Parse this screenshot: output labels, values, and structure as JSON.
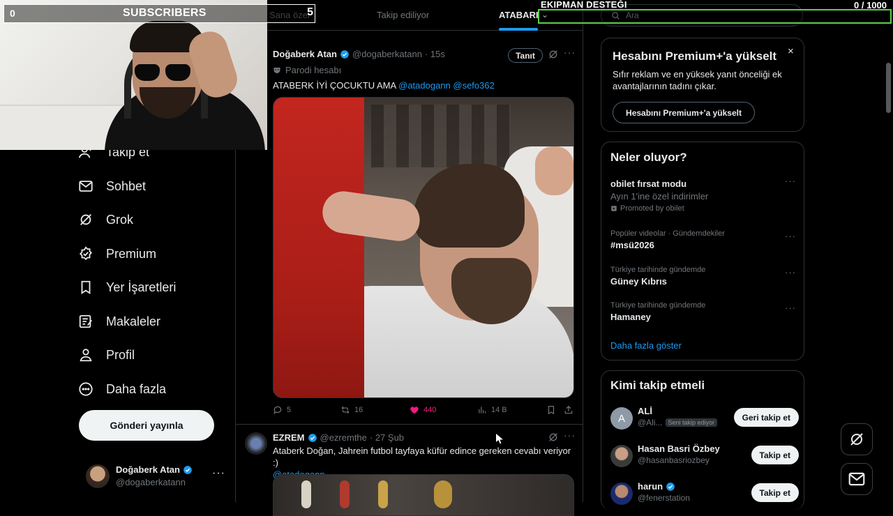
{
  "overlay": {
    "subscribers_count": "0",
    "subscribers_label": "SUBSCRIBERS",
    "subscribers_goal": "5",
    "equipment_title": "EKIPMAN DESTEĞI",
    "equipment_progress": "0   / 1000"
  },
  "nav": {
    "items": [
      {
        "label": "Takip et",
        "icon": "add-user-icon"
      },
      {
        "label": "Sohbet",
        "icon": "mail-icon"
      },
      {
        "label": "Grok",
        "icon": "grok-icon"
      },
      {
        "label": "Premium",
        "icon": "premium-icon"
      },
      {
        "label": "Yer İşaretleri",
        "icon": "bookmark-icon"
      },
      {
        "label": "Makaleler",
        "icon": "article-icon"
      },
      {
        "label": "Profil",
        "icon": "profile-icon"
      },
      {
        "label": "Daha fazla",
        "icon": "more-circle-icon"
      }
    ],
    "post_button": "Gönderi yayınla",
    "account": {
      "name": "Doğaberk Atan",
      "handle": "@dogaberkatann",
      "more": "···"
    }
  },
  "tabs": {
    "for_you": "Sana özel",
    "following": "Takip ediliyor",
    "ataberk": "ATABARI"
  },
  "tweet1": {
    "name": "Doğaberk Atan",
    "handle": "@dogaberkatann",
    "time": "· 15s",
    "follow": "Tanıt",
    "parody": "Parodi hesabı",
    "text": "ATABERK İYİ ÇOCUKTU AMA",
    "mentions": "@atadogann @sefo362",
    "replies": "5",
    "reposts": "16",
    "likes": "440",
    "views": "14 B"
  },
  "tweet2": {
    "name": "EZREM",
    "handle": "@ezremthe",
    "time": "· 27 Şub",
    "text": "Ataberk Doğan, Jahrein futbol tayfaya küfür edince gereken cevabı veriyor :)",
    "mention": "@atadogann"
  },
  "search": {
    "placeholder": "Ara"
  },
  "premium": {
    "title": "Hesabını Premium+'a yükselt",
    "description": "Sıfır reklam ve en yüksek yanıt önceliği ek avantajlarının tadını çıkar.",
    "button": "Hesabını Premium+'a yükselt",
    "close": "×"
  },
  "trends": {
    "title": "Neler oluyor?",
    "items": [
      {
        "title": "obilet fırsat modu",
        "subtitle": "Ayın 1'ine özel indirimler",
        "promo": "Promoted by obilet"
      },
      {
        "context": "Popüler videolar · Gündemdekiler",
        "title": "#msü2026"
      },
      {
        "context": "Türkiye tarihinde gündemde",
        "title": "Güney Kıbrıs"
      },
      {
        "context": "Türkiye tarihinde gündemde",
        "title": "Hamaney"
      }
    ],
    "show_more": "Daha fazla göster"
  },
  "who_to_follow": {
    "title": "Kimi takip etmeli",
    "users": [
      {
        "name": "ALİ",
        "handle": "@Ali...",
        "badge": "Seni takip ediyor",
        "button": "Geri takip et",
        "avatar_letter": "A"
      },
      {
        "name": "Hasan Basri Özbey",
        "handle": "@hasanbasriozbey",
        "button": "Takip et"
      },
      {
        "name": "harun",
        "handle": "@fenerstation",
        "button": "Takip et"
      }
    ]
  },
  "colors": {
    "accent": "#1d9bf0",
    "like": "#f91880",
    "border": "#2f3336",
    "overlay_bar": "#5fcf4d"
  }
}
